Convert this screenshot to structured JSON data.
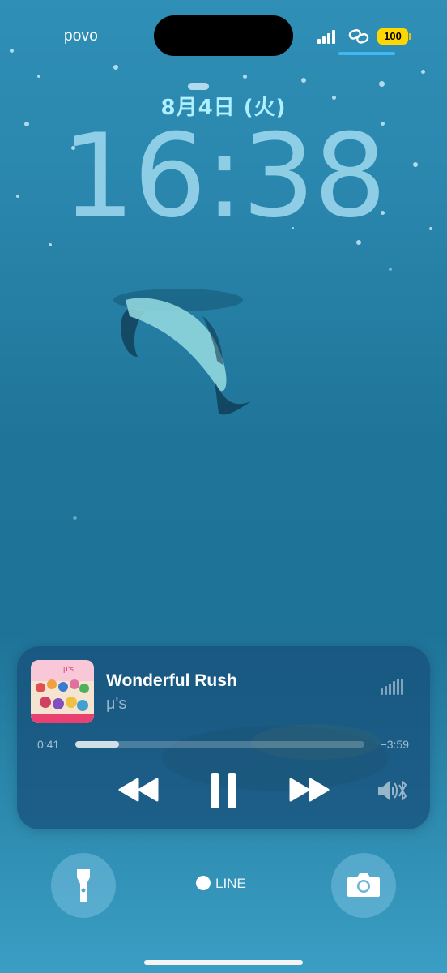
{
  "status_bar": {
    "carrier": "povo",
    "battery": "100",
    "colors": {
      "battery": "#ffd700",
      "focus": "#3fb8f3"
    }
  },
  "lock_screen": {
    "date": "8月4日 (火)",
    "time": "16:38"
  },
  "now_playing": {
    "title": "Wonderful Rush",
    "artist": "μ's",
    "elapsed": "0:41",
    "remaining": "−3:59",
    "progress": 0.15,
    "controls": [
      "rewind-icon",
      "pause-icon",
      "fast-forward-icon",
      "speaker-bluetooth-icon"
    ]
  },
  "bottom": {
    "left_button_icon": "flashlight-icon",
    "right_button_icon": "camera-icon",
    "widget_icon": "emoji-icon",
    "widget_label": "LINE"
  }
}
